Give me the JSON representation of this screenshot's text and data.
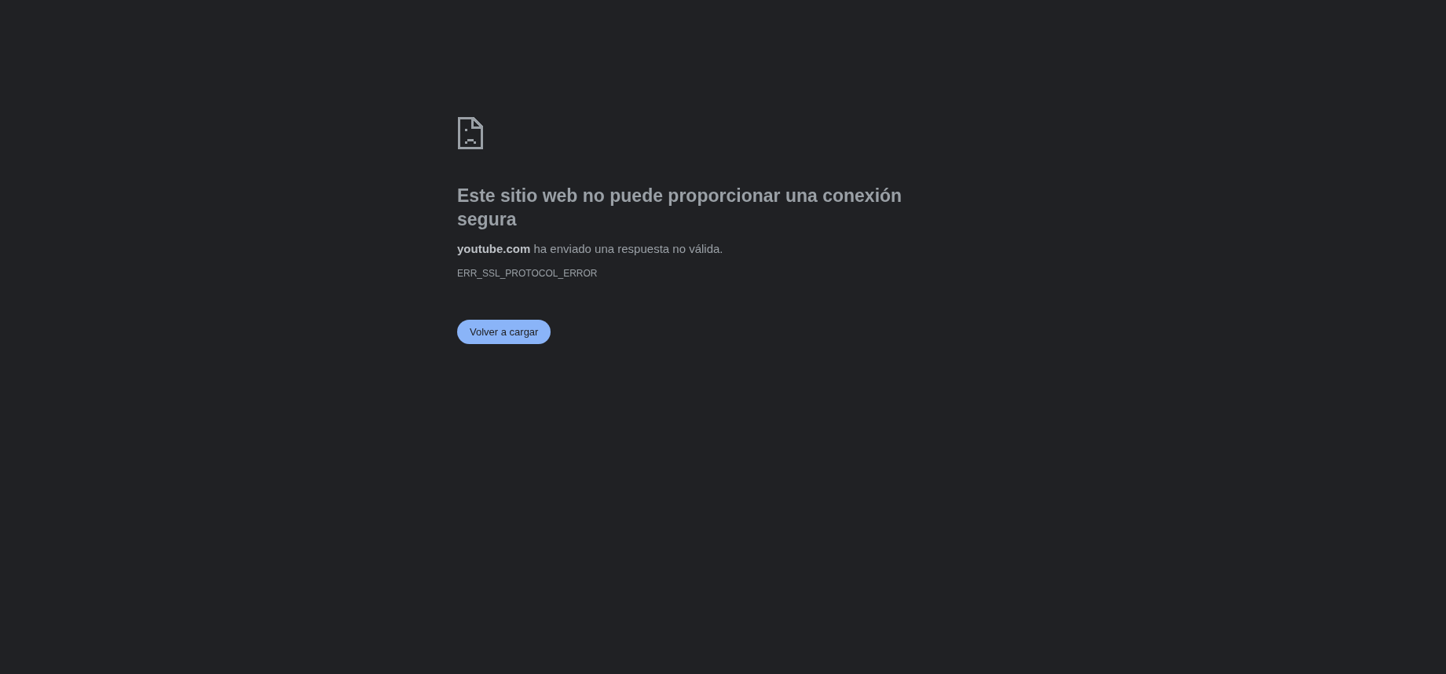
{
  "heading": "Este sitio web no puede proporcionar una conexión segura",
  "message": "**youtube.com** ha enviado una respuesta no válida.",
  "error_code": "ERR_SSL_PROTOCOL_ERROR",
  "buttons": [
    {
      "label": "Volver a cargar"
    }
  ]
}
